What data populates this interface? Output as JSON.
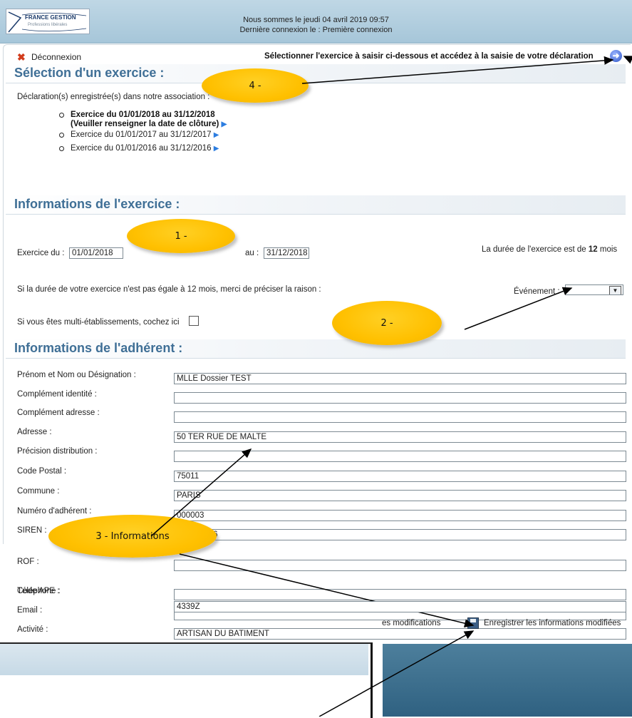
{
  "header": {
    "logo_text": "FRANCE GESTION",
    "logo_sub": "Professions libérales",
    "date_line": "Nous sommes le jeudi 04 avril 2019 09:57",
    "last_connection": "Dernière connexion le : Première connexion"
  },
  "toolbar": {
    "logout_label": "Déconnexion",
    "select_hint": "Sélectionner l'exercice à saisir ci-dessous et accédez à la saisie de votre déclaration"
  },
  "selection": {
    "title": "Sélection d'un exercice :",
    "intro": "Déclaration(s) enregistrée(s) dans notre association :",
    "items": [
      {
        "line1": "Exercice du 01/01/2018 au 31/12/2018",
        "line2": "(Veuiller renseigner la date de clôture)"
      },
      {
        "line1": "Exercice du 01/01/2017 au 31/12/2017"
      },
      {
        "line1": "Exercice du 01/01/2016 au 31/12/2016"
      }
    ]
  },
  "exercise": {
    "title": "Informations de l'exercice :",
    "from_label": "Exercice du :",
    "from_value": "01/01/2018",
    "to_label": "au :",
    "to_value": "31/12/2018",
    "duration_prefix": "La durée de l'exercice est de",
    "duration_value": "12",
    "duration_suffix": "mois",
    "reason_text": "Si la durée de votre exercice n'est pas égale à 12 mois, merci de préciser la raison :",
    "event_label": "Événement :",
    "multi_label": "Si vous êtes multi-établissements, cochez ici"
  },
  "member": {
    "title": "Informations de l'adhérent :",
    "fields": [
      {
        "label": "Prénom et Nom ou Désignation :",
        "value": "MLLE Dossier TEST"
      },
      {
        "label": "Complément identité :",
        "value": ""
      },
      {
        "label": "Complément adresse :",
        "value": ""
      },
      {
        "label": "Adresse :",
        "value": "50 TER RUE DE MALTE"
      },
      {
        "label": "Précision distribution :",
        "value": ""
      },
      {
        "label": "Code Postal :",
        "value": "75011"
      },
      {
        "label": "Commune :",
        "value": "PARIS"
      },
      {
        "label": "Numéro d'adhérent :",
        "value": "000003"
      },
      {
        "label": "SIREN :",
        "value": "812449226"
      },
      {
        "label": "ROF :",
        "value": ""
      },
      {
        "label": "Téléphone :",
        "value": ""
      },
      {
        "label": "Email :",
        "value": ""
      },
      {
        "label": "Activité :",
        "value": "ARTISAN DU BATIMENT"
      },
      {
        "label": "Code APE :",
        "value": "4339Z"
      }
    ]
  },
  "footer": {
    "partial_text": "es modifications",
    "save_label": "Enregistrer les informations modifiées"
  },
  "callouts": {
    "c1": "1 -",
    "c2": "2 -",
    "c3": "3 - Informations",
    "c4": "4 -"
  },
  "colors": {
    "section_title": "#3f6f96",
    "callout": "#ffc000",
    "header_bg": "#a6c6d9"
  }
}
